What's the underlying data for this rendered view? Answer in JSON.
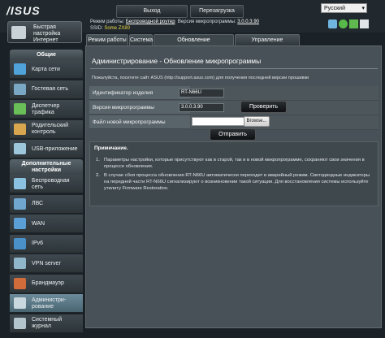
{
  "header": {
    "logo": "/ISUS",
    "logout_label": "Выход",
    "reboot_label": "Перезагрузка",
    "language": "Русский",
    "mode_label": "Режим работы:",
    "mode_value": "Беспроводной роутер",
    "firmware_label": "Версия микропрограммы:",
    "firmware_value": "3.0.0.3.90",
    "ssid_label": "SSID:",
    "ssid_values": [
      "Some",
      "ZX80"
    ]
  },
  "tabs": [
    {
      "label": "Режим работы"
    },
    {
      "label": "Система"
    },
    {
      "label": "Обновление микропрограммы"
    },
    {
      "label": "Управление настройками"
    }
  ],
  "sidebar": {
    "qis_label_1": "Быстрая",
    "qis_label_2": "настройка",
    "qis_label_3": "Интернет",
    "general_header": "Общие",
    "general_items": [
      {
        "label": "Карта сети",
        "icon": "network-map-icon",
        "color": "#4fa3d8"
      },
      {
        "label": "Гостевая сеть",
        "icon": "guest-network-icon",
        "color": "#7aa7c4"
      },
      {
        "label": "Диспетчер трафика",
        "icon": "traffic-manager-icon",
        "color": "#6bbf59"
      },
      {
        "label": "Родительский контроль",
        "icon": "parental-control-icon",
        "color": "#d8a64f"
      },
      {
        "label": "USB-приложение",
        "icon": "usb-icon",
        "color": "#9dc6db"
      }
    ],
    "advanced_header": "Дополнительные настройки",
    "advanced_items": [
      {
        "label": "Беспроводная сеть",
        "icon": "wireless-icon",
        "color": "#8ac0e0"
      },
      {
        "label": "ЛВС",
        "icon": "lan-icon",
        "color": "#6fa7cf"
      },
      {
        "label": "WAN",
        "icon": "wan-icon",
        "color": "#5aa0d6"
      },
      {
        "label": "IPv6",
        "icon": "ipv6-icon",
        "color": "#4a90c9"
      },
      {
        "label": "VPN server",
        "icon": "vpn-icon",
        "color": "#8fb6c9"
      },
      {
        "label": "Брандмауэр",
        "icon": "firewall-icon",
        "color": "#d06b3a"
      },
      {
        "label": "Администри-рование",
        "icon": "administration-icon",
        "color": "#c9d7de"
      },
      {
        "label": "Системный журнал",
        "icon": "system-log-icon",
        "color": "#b4c4cc"
      }
    ]
  },
  "main": {
    "title": "Администрирование - Обновление микропрограммы",
    "hint": "Пожалуйста, посетите сайт ASUS (http://support.asus.com) для получения последней версии прошивки",
    "product_id_label": "Идентификатор изделия",
    "product_id_value": "RT-N66U",
    "fw_version_label": "Версия микропрограммы",
    "fw_version_value": "3.0.0.3.90",
    "check_button": "Проверить",
    "new_fw_label": "Файл новой микропрограммы",
    "browse_button": "Browse...",
    "submit_button": "Отправить",
    "notes_title": "Примечание.",
    "notes": [
      "Параметры настройки, которые присутствуют как в старой, так и в новой микропрограмме, сохраняют свои значения в процессе обновления.",
      "В случае сбоя процесса обновления RT-N66U автоматически переходит в аварийный режим. Светодиодные индикаторы на передней части RT-N66U сигнализируют о возникновении такой ситуации. Для восстановления системы используйте утилиту Firmware Restoration."
    ]
  }
}
